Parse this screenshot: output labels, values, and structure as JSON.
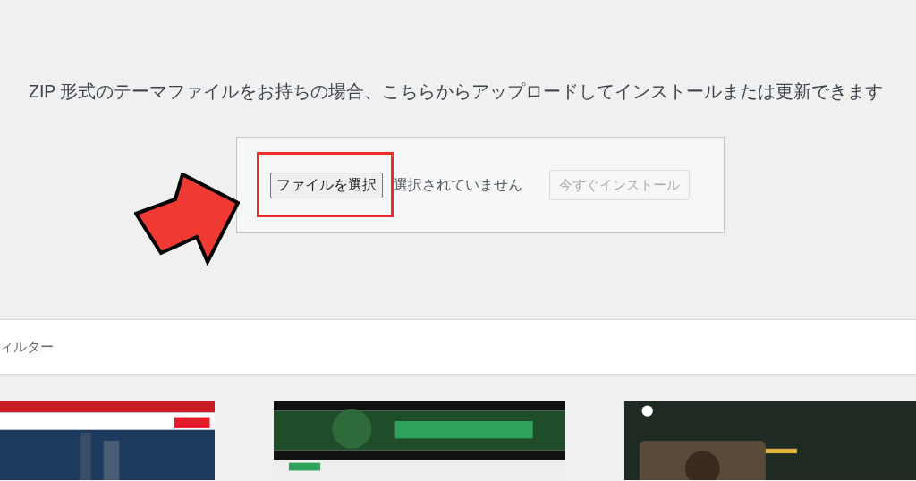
{
  "description": "ZIP 形式のテーマファイルをお持ちの場合、こちらからアップロードしてインストールまたは更新できます",
  "upload": {
    "choose_button": "ファイルを選択",
    "file_status": "選択されていません",
    "install_button": {
      "label": "今すぐインストール",
      "disabled": true
    }
  },
  "annotations": {
    "highlight": true,
    "arrow": true
  },
  "filter_bar": {
    "label": "ィルター"
  }
}
